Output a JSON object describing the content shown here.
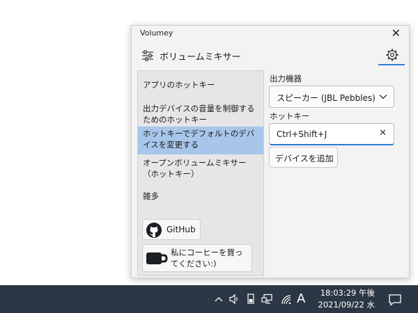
{
  "window": {
    "title": "Volumey",
    "close_glyph": "✕",
    "app_name": "ボリュームミキサー",
    "accent": "#2a7bd6"
  },
  "sidebar": {
    "items": [
      {
        "label": "アプリのホットキー",
        "selected": false
      },
      {
        "label": "出力デバイスの音量を制御するためのホットキー",
        "selected": false
      },
      {
        "label": "ホットキーでデフォルトのデバイスを変更する",
        "selected": true
      },
      {
        "label": "オープンボリュームミキサー（ホットキー）",
        "selected": false
      },
      {
        "label": "雑多",
        "selected": false
      }
    ],
    "github_label": "GitHub",
    "coffee_label": "私にコーヒーを買ってください:)"
  },
  "main": {
    "output_label": "出力機器",
    "output_value": "スピーカー (JBL Pebbles)",
    "hotkey_label": "ホットキー",
    "hotkey_value": "Ctrl+Shift+J",
    "clear_glyph": "✕",
    "add_device_label": "デバイスを追加"
  },
  "taskbar": {
    "ime_label": "A",
    "time": "18:03:29 午後",
    "date": "2021/09/22 水",
    "background": "#2b3744"
  }
}
